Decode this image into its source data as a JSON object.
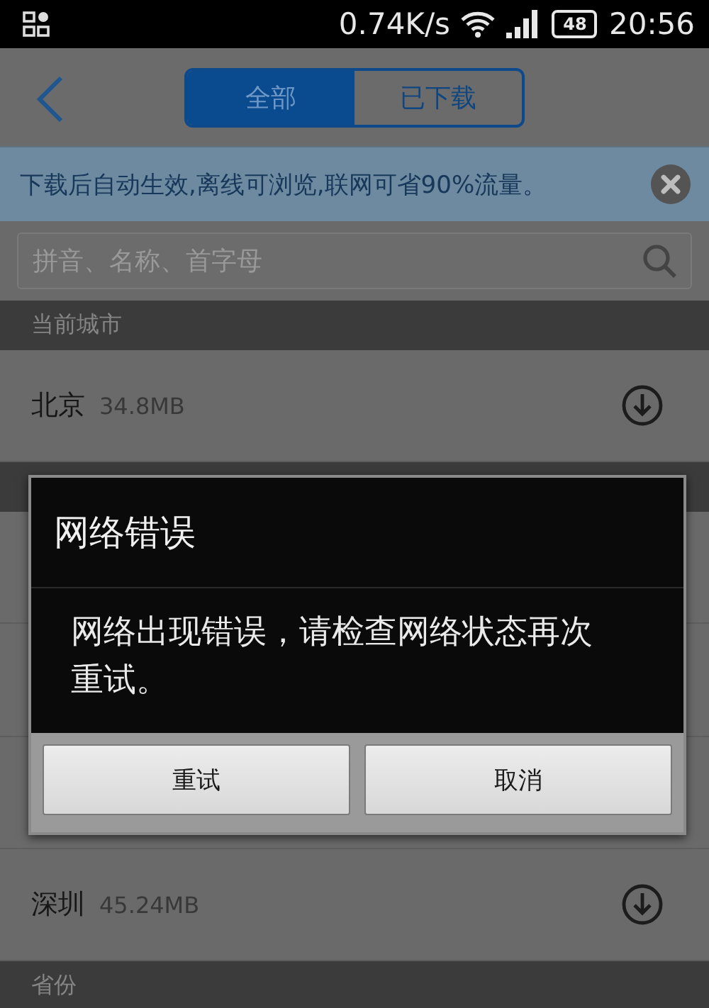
{
  "status_bar": {
    "speed": "0.74K/s",
    "battery": "48",
    "time": "20:56"
  },
  "nav": {
    "tabs": [
      {
        "label": "全部",
        "selected": true
      },
      {
        "label": "已下载",
        "selected": false
      }
    ]
  },
  "banner": {
    "text": "下载后自动生效,离线可浏览,联网可省90%流量。"
  },
  "search": {
    "placeholder": "拼音、名称、首字母"
  },
  "current_city": {
    "title": "当前城市",
    "rows": [
      {
        "name": "北京",
        "size": "34.8MB"
      }
    ]
  },
  "rows_below_dialog": [
    {
      "name": "深圳",
      "size": "45.24MB"
    }
  ],
  "next_section": {
    "title": "省份"
  },
  "dialog": {
    "title": "网络错误",
    "message": "网络出现错误，请检查网络状态再次重试。",
    "buttons": [
      "重试",
      "取消"
    ]
  }
}
